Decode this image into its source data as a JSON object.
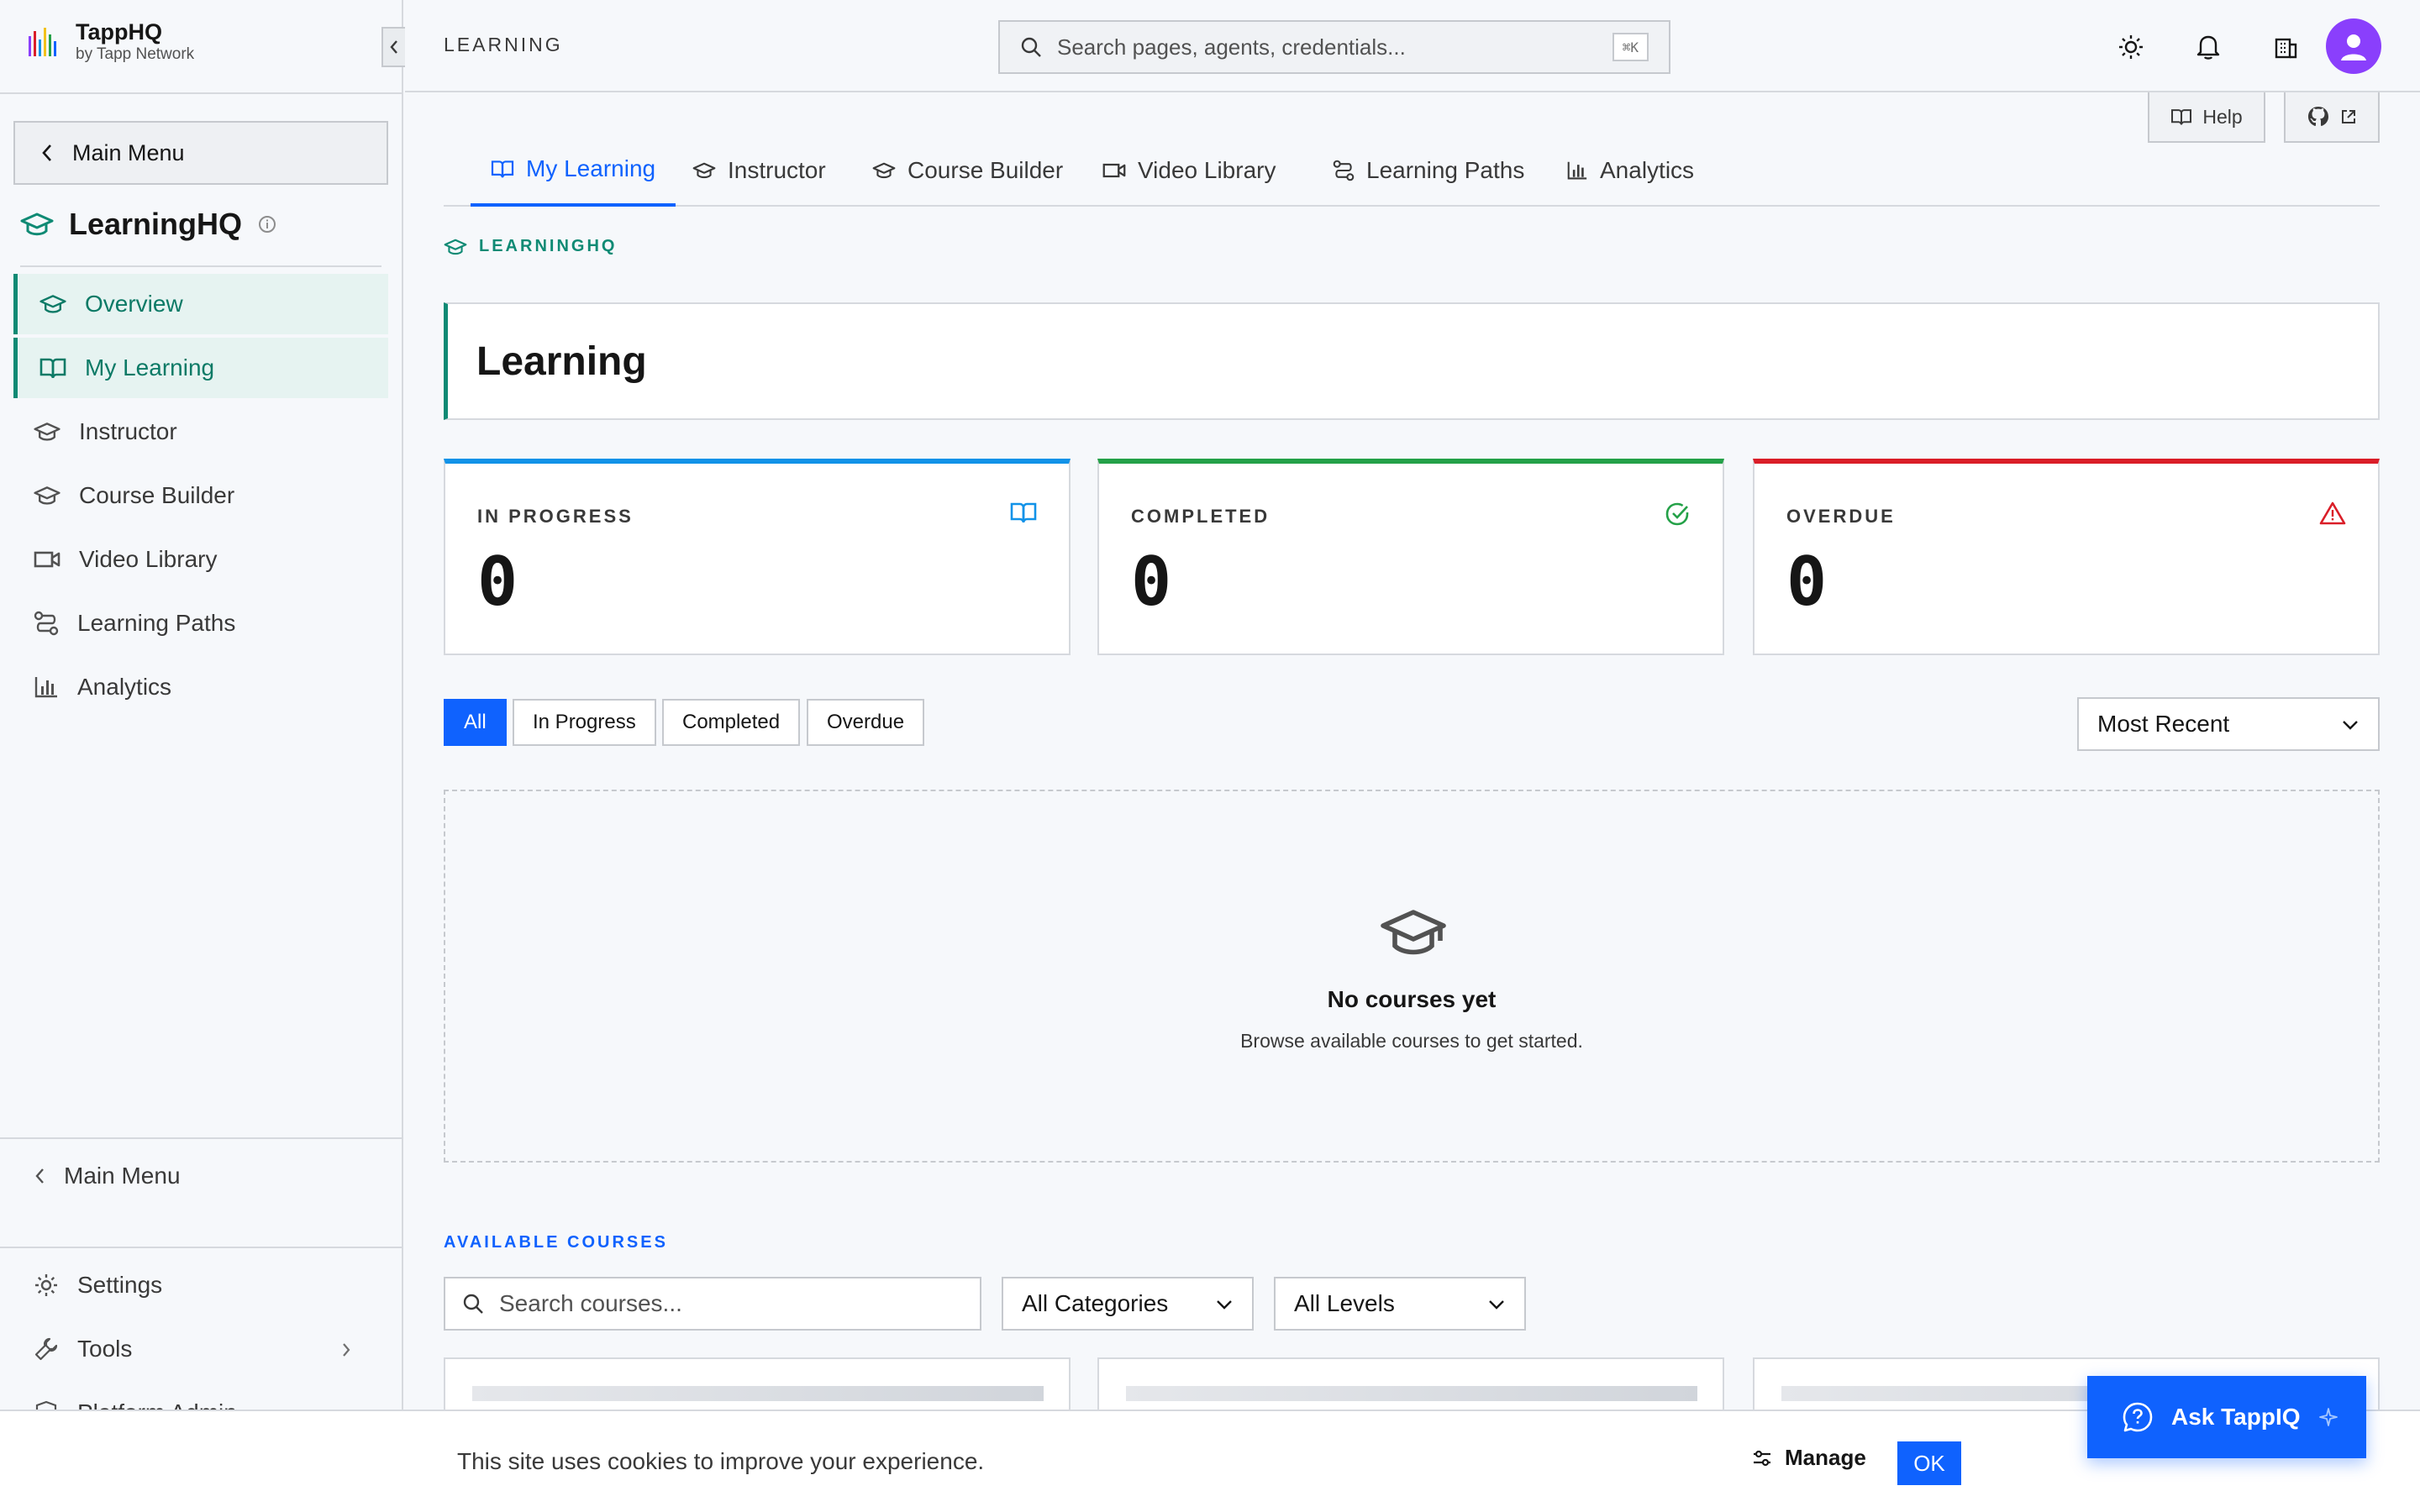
{
  "brand": {
    "name": "TappHQ",
    "subtitle": "by Tapp Network"
  },
  "sidebar": {
    "main_menu_label": "Main Menu",
    "section_title": "LearningHQ",
    "items": [
      {
        "label": "Overview",
        "icon": "graduation-cap-icon",
        "active": true
      },
      {
        "label": "My Learning",
        "icon": "book-open-icon",
        "active": true
      },
      {
        "label": "Instructor",
        "icon": "graduation-cap-icon",
        "active": false
      },
      {
        "label": "Course Builder",
        "icon": "graduation-cap-icon",
        "active": false
      },
      {
        "label": "Video Library",
        "icon": "video-icon",
        "active": false
      },
      {
        "label": "Learning Paths",
        "icon": "route-icon",
        "active": false
      },
      {
        "label": "Analytics",
        "icon": "bar-chart-icon",
        "active": false
      }
    ],
    "bottom": {
      "main_menu_label": "Main Menu",
      "settings_label": "Settings",
      "tools_label": "Tools",
      "platform_admin_label": "Platform Admin"
    }
  },
  "header": {
    "breadcrumb": "LEARNING",
    "search_placeholder": "Search pages, agents, credentials...",
    "search_shortcut": "⌘K",
    "help_label": "Help"
  },
  "tabs": [
    {
      "label": "My Learning",
      "icon": "book-open-icon",
      "active": true
    },
    {
      "label": "Instructor",
      "icon": "graduation-cap-icon",
      "active": false
    },
    {
      "label": "Course Builder",
      "icon": "graduation-cap-icon",
      "active": false
    },
    {
      "label": "Video Library",
      "icon": "video-icon",
      "active": false
    },
    {
      "label": "Learning Paths",
      "icon": "route-icon",
      "active": false
    },
    {
      "label": "Analytics",
      "icon": "bar-chart-icon",
      "active": false
    }
  ],
  "page": {
    "eyebrow": "LEARNINGHQ",
    "title": "Learning"
  },
  "stats": [
    {
      "label": "IN PROGRESS",
      "value": "0",
      "color": "#1192e8",
      "icon": "book-open-icon"
    },
    {
      "label": "COMPLETED",
      "value": "0",
      "color": "#24a148",
      "icon": "check-circle-icon"
    },
    {
      "label": "OVERDUE",
      "value": "0",
      "color": "#da1e28",
      "icon": "warning-icon"
    }
  ],
  "filters": {
    "chips": [
      "All",
      "In Progress",
      "Completed",
      "Overdue"
    ],
    "active_chip": "All",
    "sort_value": "Most Recent"
  },
  "empty_state": {
    "title": "No courses yet",
    "subtitle": "Browse available courses to get started."
  },
  "available_courses": {
    "heading": "AVAILABLE COURSES",
    "search_placeholder": "Search courses...",
    "category_value": "All Categories",
    "level_value": "All Levels"
  },
  "cookie": {
    "text": "This site uses cookies to improve your experience.",
    "manage_label": "Manage",
    "ok_label": "OK"
  },
  "assistant": {
    "label": "Ask TappIQ"
  },
  "colors": {
    "accent": "#0f62fe",
    "brand_teal": "#0f8a74",
    "avatar": "#8a3ffc"
  }
}
